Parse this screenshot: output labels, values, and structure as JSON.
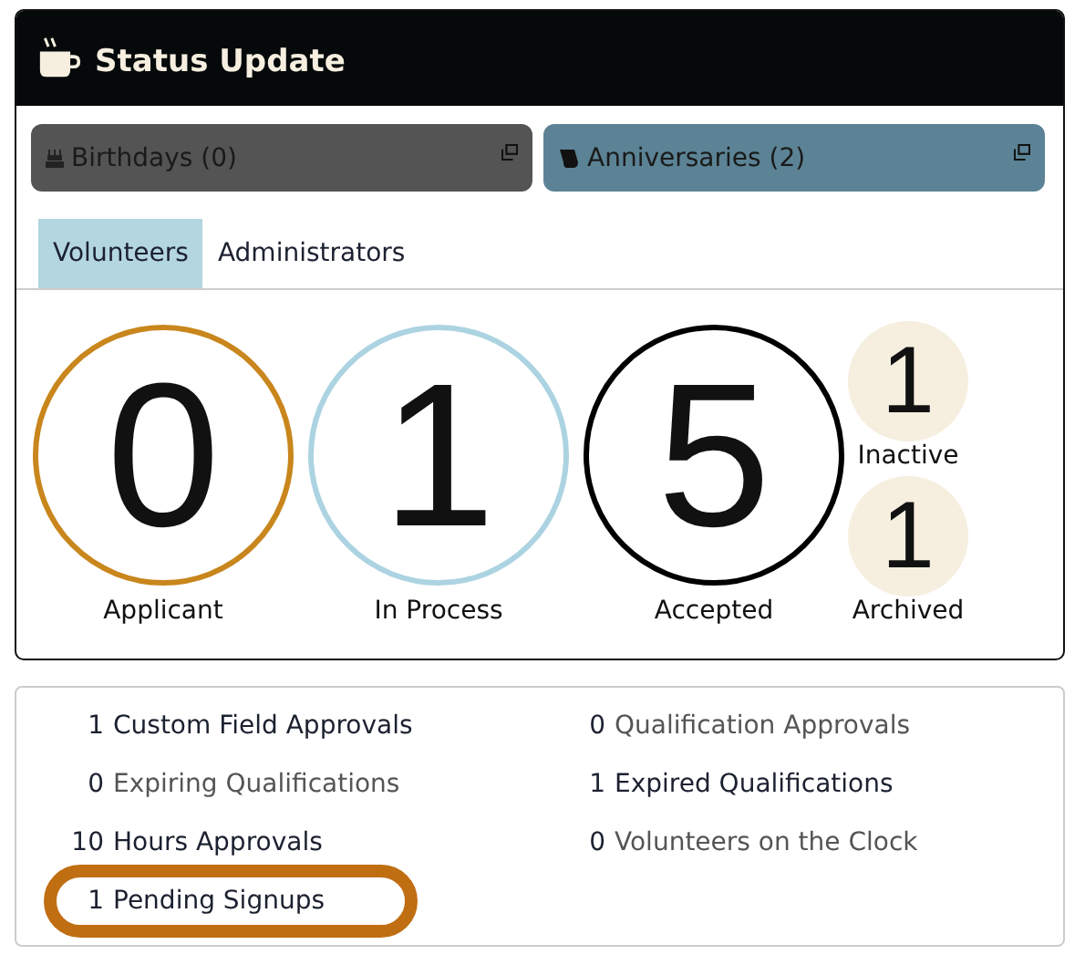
{
  "panel": {
    "title": "Status Update"
  },
  "links": [
    {
      "label": "Birthdays (0)",
      "kind": "birthday"
    },
    {
      "label": "Anniversaries (2)",
      "kind": "anniversary"
    }
  ],
  "tabs": [
    {
      "label": "Volunteers",
      "selected": true
    },
    {
      "label": "Administrators",
      "selected": false
    }
  ],
  "counters": [
    {
      "count": "0",
      "label": "Applicant",
      "kind": "large",
      "color": "#c8861c"
    },
    {
      "count": "1",
      "label": "In Process",
      "kind": "large",
      "color": "#acd3e1"
    },
    {
      "count": "5",
      "label": "Accepted",
      "kind": "large",
      "color": "#000000"
    },
    {
      "count": "1",
      "label": "Inactive",
      "kind": "small",
      "color": "#f6efe0"
    },
    {
      "count": "1",
      "label": "Archived",
      "kind": "small",
      "color": "#f6efe0"
    }
  ],
  "tasks": [
    {
      "count": "1",
      "label": "Custom Field Approvals",
      "muted": false,
      "highlighted": false
    },
    {
      "count": "0",
      "label": "Qualification Approvals",
      "muted": true,
      "highlighted": false
    },
    {
      "count": "0",
      "label": "Expiring Qualifications",
      "muted": true,
      "highlighted": false
    },
    {
      "count": "1",
      "label": "Expired Qualifications",
      "muted": false,
      "highlighted": false
    },
    {
      "count": "10",
      "label": "Hours Approvals",
      "muted": false,
      "highlighted": false
    },
    {
      "count": "0",
      "label": "Volunteers on the Clock",
      "muted": true,
      "highlighted": false
    },
    {
      "count": "1",
      "label": "Pending Signups",
      "muted": false,
      "highlighted": true
    }
  ]
}
